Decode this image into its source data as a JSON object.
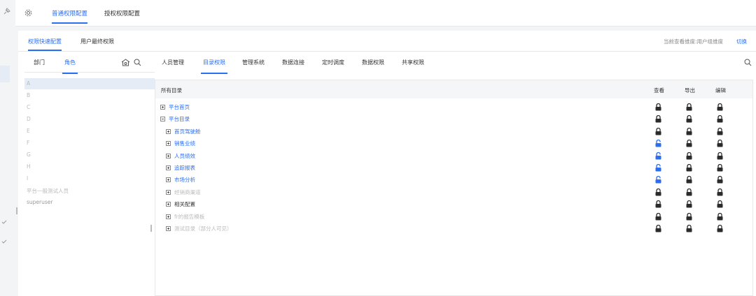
{
  "top_tabs": [
    "普通权限配置",
    "授权权限配置"
  ],
  "sub_tabs": [
    "权限快速配置",
    "用户最终权限"
  ],
  "dimension": {
    "label": "当前查看维度:用户组维度",
    "switch_label": "切换"
  },
  "left_tabs": [
    "部门",
    "角色"
  ],
  "roles": [
    "A",
    "B",
    "C",
    "D",
    "E",
    "F",
    "G",
    "H",
    "I",
    "平台一般测试人员",
    "superuser"
  ],
  "resource_tabs": [
    "人员管理",
    "目录权限",
    "管理系统",
    "数据连接",
    "定时调度",
    "数据权限",
    "共享权限"
  ],
  "table": {
    "headers": {
      "name": "所有目录",
      "view": "查看",
      "export": "导出",
      "edit": "编辑"
    },
    "rows": [
      {
        "label": "平台首页",
        "toggle": "plus",
        "color": "blue",
        "locks": [
          "locked",
          "locked",
          "locked"
        ]
      },
      {
        "label": "平台目录",
        "toggle": "minus",
        "color": "blue",
        "locks": [
          "locked",
          "locked",
          "locked"
        ]
      },
      {
        "label": "首页驾驶舱",
        "toggle": "plus",
        "color": "blue",
        "locks": [
          "locked",
          "locked",
          "locked"
        ]
      },
      {
        "label": "销售业绩",
        "toggle": "plus",
        "color": "blue",
        "locks": [
          "unlocked",
          "locked",
          "locked"
        ]
      },
      {
        "label": "人员绩效",
        "toggle": "plus",
        "color": "blue",
        "locks": [
          "unlocked",
          "locked",
          "locked"
        ]
      },
      {
        "label": "追踪报表",
        "toggle": "plus",
        "color": "blue",
        "locks": [
          "unlocked",
          "locked",
          "locked"
        ]
      },
      {
        "label": "市场分析",
        "toggle": "plus",
        "color": "blue",
        "locks": [
          "unlocked",
          "locked",
          "locked"
        ]
      },
      {
        "label": "经销商渠道",
        "toggle": "plus",
        "color": "gray",
        "locks": [
          "locked",
          "locked",
          "locked"
        ]
      },
      {
        "label": "相关配置",
        "toggle": "plus",
        "color": "dark",
        "locks": [
          "locked",
          "locked",
          "locked"
        ]
      },
      {
        "label": "fr的报告模板",
        "toggle": "plus",
        "color": "gray",
        "locks": [
          "locked",
          "locked",
          "locked"
        ]
      },
      {
        "label": "测试目录（部分人可见）",
        "toggle": "plus",
        "color": "gray",
        "locks": [
          "locked",
          "locked",
          "locked"
        ]
      }
    ]
  },
  "colors": {
    "accent": "#2a6ef2",
    "lock_dark": "#2b2b2b"
  },
  "icons": [
    "gear-icon",
    "pin-icon",
    "home-settings-icon",
    "search-icon",
    "check-icon",
    "lock-icon",
    "unlock-icon"
  ]
}
